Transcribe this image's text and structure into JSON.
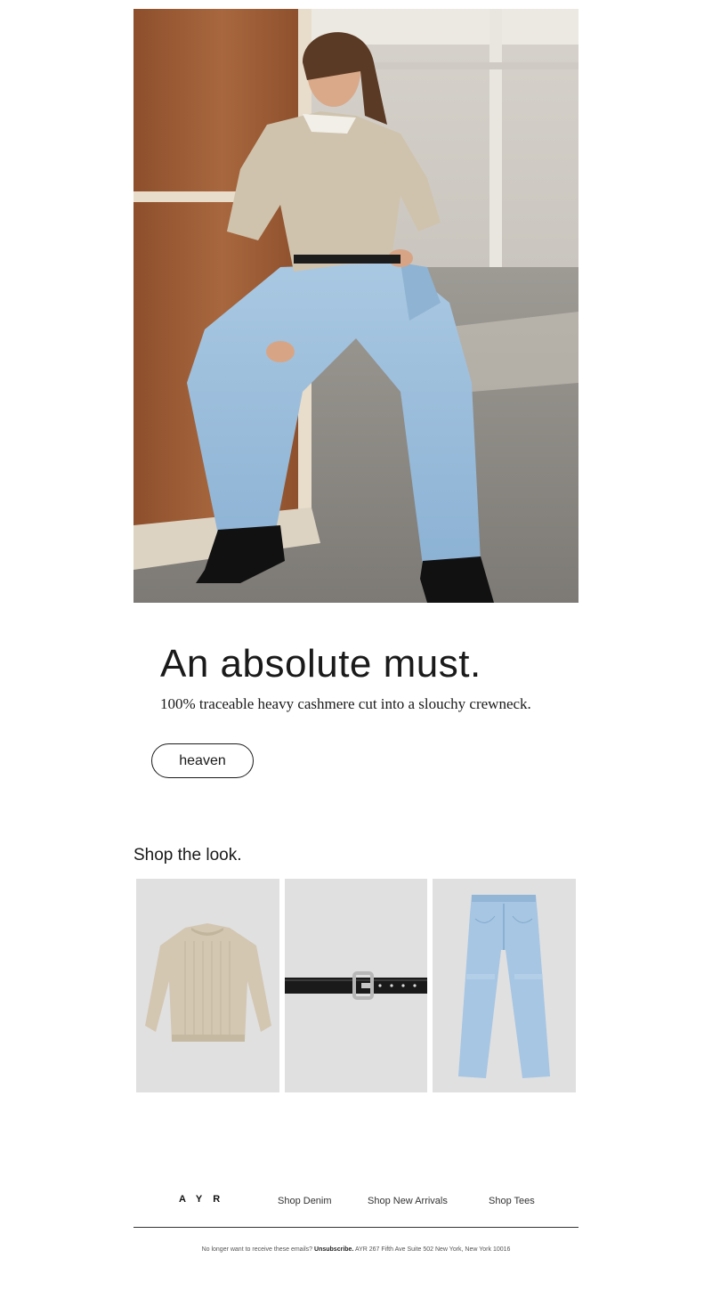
{
  "hero": {
    "image_icon": "woman-in-sweater-and-jeans-photo"
  },
  "headline": "An absolute must.",
  "subline": "100% traceable heavy cashmere cut into a slouchy crewneck.",
  "cta_label": "heaven",
  "shop": {
    "title": "Shop the look.",
    "products": [
      {
        "icon": "cashmere-sweater-image"
      },
      {
        "icon": "leather-belt-image"
      },
      {
        "icon": "light-wash-jeans-image"
      }
    ]
  },
  "footer": {
    "logo": "AYR",
    "links": [
      "Shop Denim",
      "Shop New Arrivals",
      "Shop Tees"
    ],
    "unsubscribe_prefix": "No longer want to receive these emails?",
    "unsubscribe_label": "Unsubscribe.",
    "address": "AYR 267 Fifth Ave Suite 502 New York, New York 10016"
  },
  "colors": {
    "text": "#1a1a1a",
    "product_bg": "#e0e0e0",
    "denim": "#9cbfdc",
    "sweater": "#cfc3ad",
    "wood": "#9a5a33"
  }
}
